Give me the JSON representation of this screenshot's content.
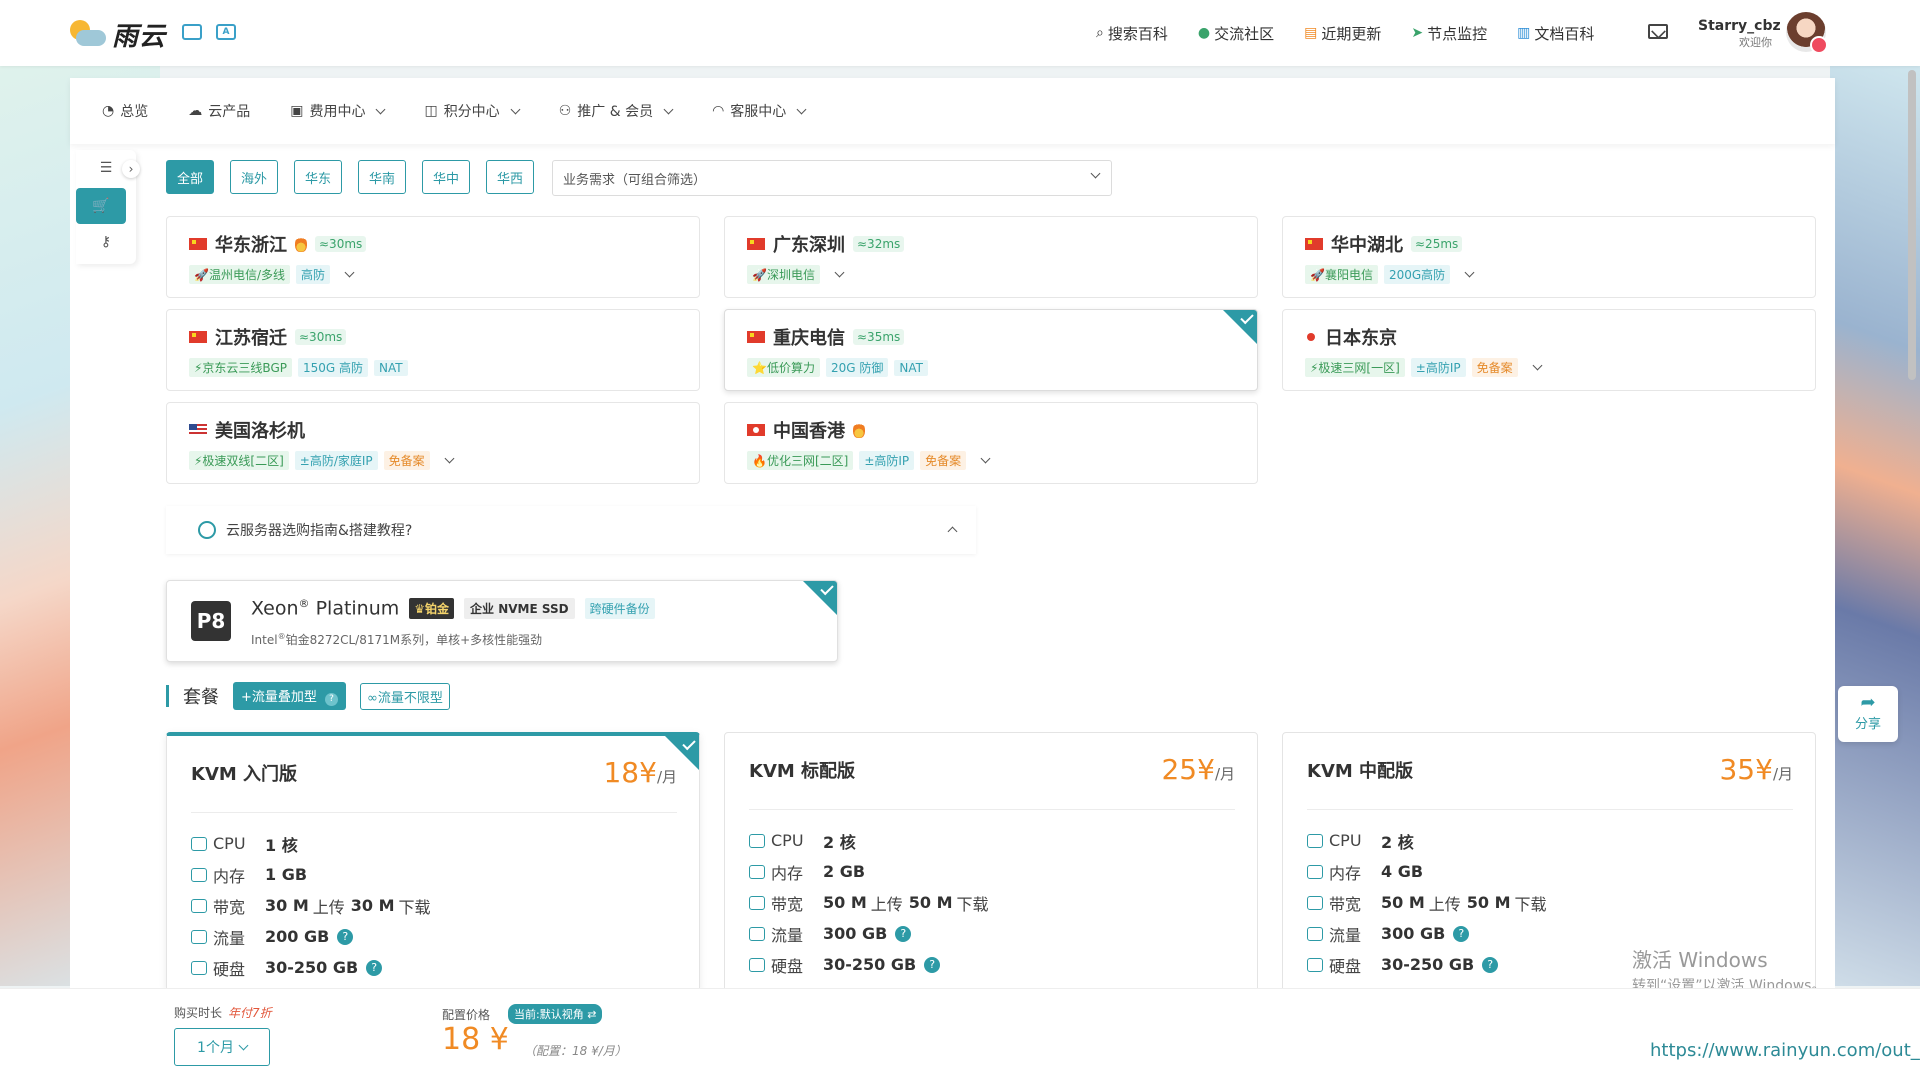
{
  "header": {
    "logo_text": "雨云",
    "nav": [
      {
        "icon": "search-icon",
        "glyph": "⌕",
        "label": "搜索百科",
        "color": "#333333"
      },
      {
        "icon": "chat-icon",
        "glyph": "●",
        "label": "交流社区",
        "color": "#3aa36b"
      },
      {
        "icon": "news-icon",
        "glyph": "▤",
        "label": "近期更新",
        "color": "#f08a24"
      },
      {
        "icon": "send-icon",
        "glyph": "➤",
        "label": "节点监控",
        "color": "#3aa36b"
      },
      {
        "icon": "book-icon",
        "glyph": "▥",
        "label": "文档百科",
        "color": "#2d8ed6"
      }
    ],
    "user_name": "Starry_cbz",
    "user_welcome": "欢迎你"
  },
  "main_nav": [
    {
      "icon": "dashboard-icon",
      "glyph": "◔",
      "label": "总览",
      "has_menu": false
    },
    {
      "icon": "cloud-products-icon",
      "glyph": "☁",
      "label": "云产品",
      "has_menu": false
    },
    {
      "icon": "billing-icon",
      "glyph": "▣",
      "label": "费用中心",
      "has_menu": true
    },
    {
      "icon": "gift-icon",
      "glyph": "◫",
      "label": "积分中心",
      "has_menu": true
    },
    {
      "icon": "users-icon",
      "glyph": "⚇",
      "label": "推广 & 会员",
      "has_menu": true
    },
    {
      "icon": "headset-icon",
      "glyph": "◠",
      "label": "客服中心",
      "has_menu": true
    }
  ],
  "region_filters": [
    "全部",
    "海外",
    "华东",
    "华南",
    "华中",
    "华西"
  ],
  "active_filter": 0,
  "requirement_select": "业务需求（可组合筛选）",
  "regions": [
    {
      "flag": "cn",
      "name": "华东浙江",
      "hot": true,
      "ping": "≈30ms",
      "tags": [
        {
          "text": "🚀温州电信/多线",
          "color": "green"
        },
        {
          "text": "高防",
          "color": "blue"
        }
      ],
      "expand": true,
      "selected": false
    },
    {
      "flag": "cn",
      "name": "广东深圳",
      "hot": false,
      "ping": "≈32ms",
      "tags": [
        {
          "text": "🚀深圳电信",
          "color": "green"
        }
      ],
      "expand": true,
      "selected": false
    },
    {
      "flag": "cn",
      "name": "华中湖北",
      "hot": false,
      "ping": "≈25ms",
      "tags": [
        {
          "text": "🚀襄阳电信",
          "color": "green"
        },
        {
          "text": "200G高防",
          "color": "blue"
        }
      ],
      "expand": true,
      "selected": false
    },
    {
      "flag": "cn",
      "name": "江苏宿迁",
      "hot": false,
      "ping": "≈30ms",
      "tags": [
        {
          "text": "⚡京东云三线BGP",
          "color": "green"
        },
        {
          "text": "150G 高防",
          "color": "blue"
        },
        {
          "text": "NAT",
          "color": "blue"
        }
      ],
      "expand": false,
      "selected": false
    },
    {
      "flag": "cn",
      "name": "重庆电信",
      "hot": false,
      "ping": "≈35ms",
      "tags": [
        {
          "text": "⭐低价算力",
          "color": "green"
        },
        {
          "text": "20G 防御",
          "color": "blue"
        },
        {
          "text": "NAT",
          "color": "blue"
        }
      ],
      "expand": false,
      "selected": true
    },
    {
      "flag": "jp",
      "name": "日本东京",
      "hot": false,
      "ping": "",
      "tags": [
        {
          "text": "⚡极速三网[一区]",
          "color": "green"
        },
        {
          "text": "±高防IP",
          "color": "blue"
        },
        {
          "text": "免备案",
          "color": "orange"
        }
      ],
      "expand": true,
      "selected": false
    },
    {
      "flag": "us",
      "name": "美国洛杉机",
      "hot": false,
      "ping": "",
      "tags": [
        {
          "text": "⚡极速双线[二区]",
          "color": "green"
        },
        {
          "text": "±高防/家庭IP",
          "color": "blue"
        },
        {
          "text": "免备案",
          "color": "orange"
        }
      ],
      "expand": true,
      "selected": false
    },
    {
      "flag": "hk",
      "name": "中国香港",
      "hot": true,
      "ping": "",
      "tags": [
        {
          "text": "🔥优化三网[二区]",
          "color": "green"
        },
        {
          "text": "±高防IP",
          "color": "blue"
        },
        {
          "text": "免备案",
          "color": "orange"
        }
      ],
      "expand": true,
      "selected": false
    }
  ],
  "guide": {
    "label": "云服务器选购指南&搭建教程?"
  },
  "cpu": {
    "badge": "P8",
    "name": "Xeon",
    "reg": "®",
    "name2": "Platinum",
    "tag_tier": "♛铂金",
    "tag_disk": "企业 NVME SSD",
    "tag_backup": "跨硬件备份",
    "desc_a": "Intel",
    "desc_b": "铂金8272CL/8171M系列，单核+多核性能强劲"
  },
  "plans_header": {
    "title": "套餐",
    "btn_traffic": "+流量叠加型",
    "btn_info": "?",
    "btn_unlimited": "∞流量不限型"
  },
  "plans": [
    {
      "name": "KVM 入门版",
      "price": "18¥",
      "unit": "/月",
      "selected": true,
      "cpu": "1 核",
      "ram": "1 GB",
      "bw_up": "30 M",
      "bw_down": "30 M",
      "traffic": "200 GB",
      "disk": "30-250 GB"
    },
    {
      "name": "KVM 标配版",
      "price": "25¥",
      "unit": "/月",
      "selected": false,
      "cpu": "2 核",
      "ram": "2 GB",
      "bw_up": "50 M",
      "bw_down": "50 M",
      "traffic": "300 GB",
      "disk": "30-250 GB"
    },
    {
      "name": "KVM 中配版",
      "price": "35¥",
      "unit": "/月",
      "selected": false,
      "cpu": "2 核",
      "ram": "4 GB",
      "bw_up": "50 M",
      "bw_down": "50 M",
      "traffic": "300 GB",
      "disk": "30-250 GB"
    }
  ],
  "spec_labels": {
    "cpu": "CPU",
    "ram": "内存",
    "bw": "带宽",
    "traffic": "流量",
    "disk": "硬盘",
    "up": "上传",
    "down": "下载"
  },
  "share": {
    "label": "分享"
  },
  "watermark": {
    "line1": "激活 Windows",
    "line2": "转到“设置”以激活 Windows。"
  },
  "bottom": {
    "duration_label": "购买时长",
    "duration_discount": "年付7折",
    "duration_value": "1个月",
    "price_label": "配置价格",
    "view_pill": "当前:默认视角 ⇄",
    "total": "18 ¥",
    "total_note": "（配置：18 ¥/月）"
  },
  "status_url": "https://www.rainyun.com/out_"
}
